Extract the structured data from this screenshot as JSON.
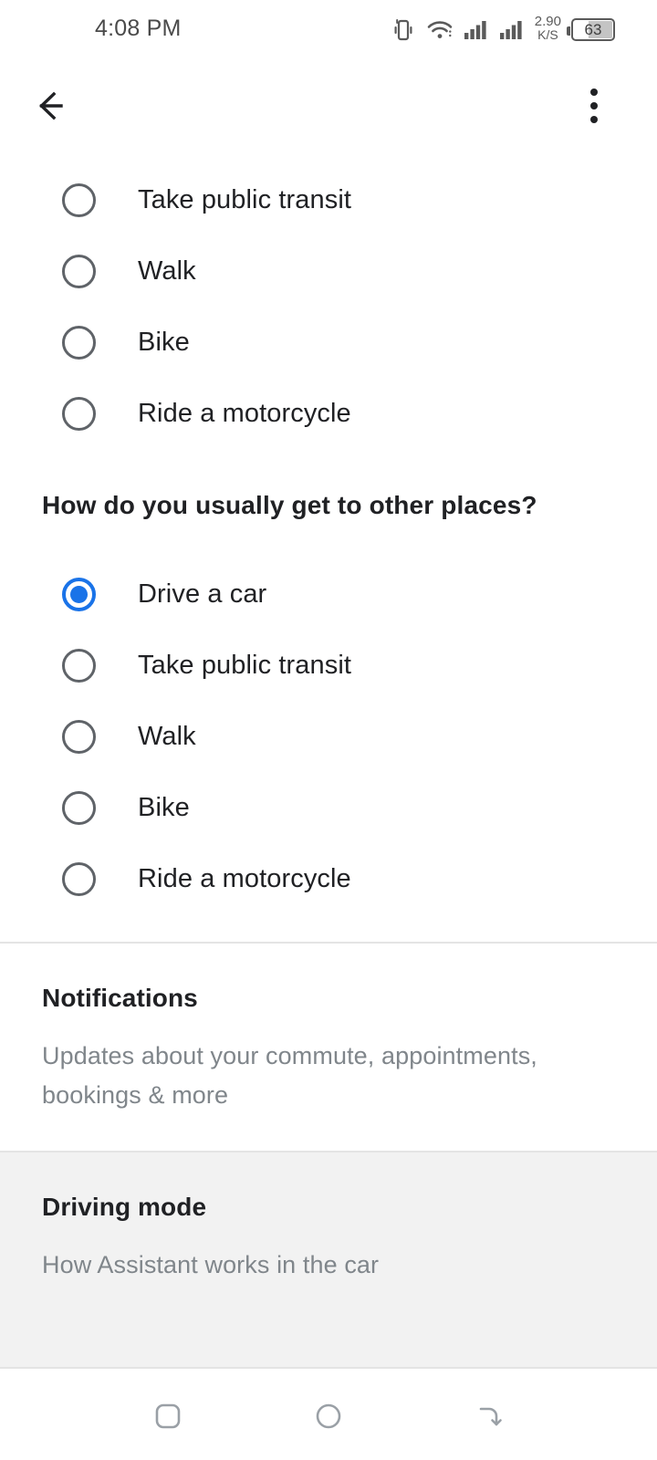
{
  "status_bar": {
    "time": "4:08 PM",
    "icons": [
      "vibrate-icon",
      "wifi-icon",
      "signal-1-icon",
      "signal-2-icon"
    ],
    "net_speed_value": "2.90",
    "net_speed_unit": "K/S",
    "battery_percent": "63"
  },
  "app_bar": {
    "back_icon": "back-arrow-icon",
    "overflow_icon": "overflow-menu-icon"
  },
  "groups": [
    {
      "title": null,
      "options": [
        {
          "label": "Take public transit",
          "selected": false
        },
        {
          "label": "Walk",
          "selected": false
        },
        {
          "label": "Bike",
          "selected": false
        },
        {
          "label": "Ride a motorcycle",
          "selected": false
        }
      ]
    },
    {
      "title": "How do you usually get to other places?",
      "options": [
        {
          "label": "Drive a car",
          "selected": true
        },
        {
          "label": "Take public transit",
          "selected": false
        },
        {
          "label": "Walk",
          "selected": false
        },
        {
          "label": "Bike",
          "selected": false
        },
        {
          "label": "Ride a motorcycle",
          "selected": false
        }
      ]
    }
  ],
  "sections": [
    {
      "title": "Notifications",
      "subtitle": "Updates about your commute, appointments, bookings & more",
      "highlighted": false
    },
    {
      "title": "Driving mode",
      "subtitle": "How Assistant works in the car",
      "highlighted": true
    }
  ],
  "nav_bar": {
    "recents_icon": "square-recents-icon",
    "home_icon": "circle-home-icon",
    "back_icon": "back-curve-icon"
  },
  "colors": {
    "accent": "#1a73e8",
    "text_primary": "#202124",
    "text_secondary": "#80868b",
    "radio_border": "#5f6368",
    "divider": "#e4e4e4",
    "highlight_bg": "#f2f2f2"
  }
}
